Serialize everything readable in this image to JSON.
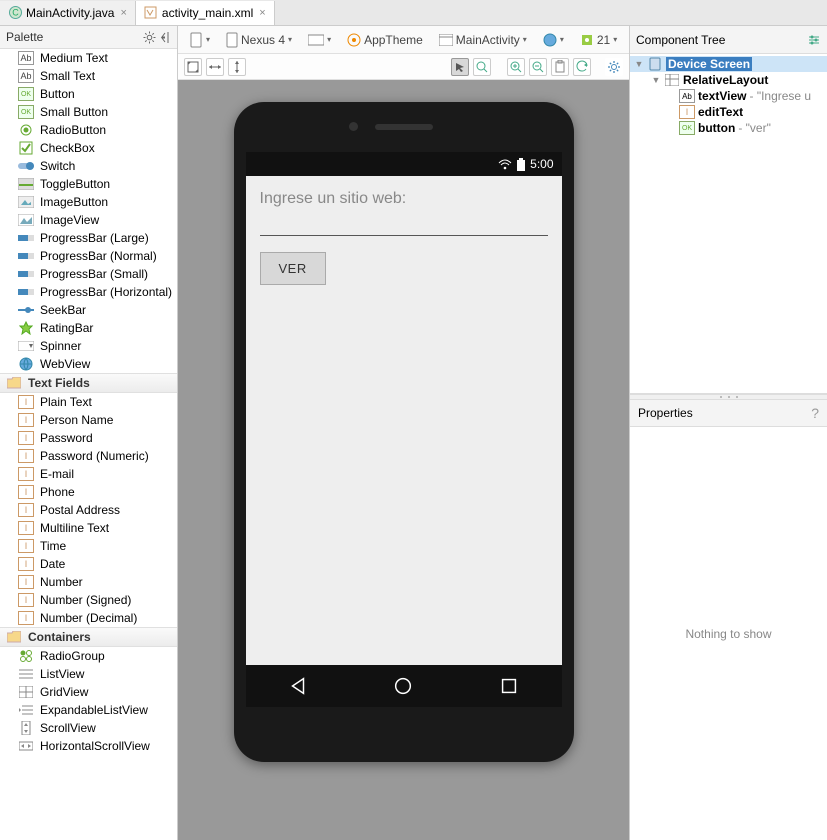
{
  "tabs": [
    {
      "label": "MainActivity.java",
      "icon": "class",
      "active": false
    },
    {
      "label": "activity_main.xml",
      "icon": "xml",
      "active": true
    }
  ],
  "palette": {
    "title": "Palette",
    "items": [
      {
        "label": "Medium Text",
        "icon": "Ab"
      },
      {
        "label": "Small Text",
        "icon": "Ab"
      },
      {
        "label": "Button",
        "icon": "OK"
      },
      {
        "label": "Small Button",
        "icon": "OK"
      },
      {
        "label": "RadioButton",
        "icon": "radio"
      },
      {
        "label": "CheckBox",
        "icon": "check"
      },
      {
        "label": "Switch",
        "icon": "switch"
      },
      {
        "label": "ToggleButton",
        "icon": "toggle"
      },
      {
        "label": "ImageButton",
        "icon": "imgbtn"
      },
      {
        "label": "ImageView",
        "icon": "img"
      },
      {
        "label": "ProgressBar (Large)",
        "icon": "bar"
      },
      {
        "label": "ProgressBar (Normal)",
        "icon": "bar"
      },
      {
        "label": "ProgressBar (Small)",
        "icon": "bar"
      },
      {
        "label": "ProgressBar (Horizontal)",
        "icon": "bar"
      },
      {
        "label": "SeekBar",
        "icon": "seek"
      },
      {
        "label": "RatingBar",
        "icon": "star"
      },
      {
        "label": "Spinner",
        "icon": "spin"
      },
      {
        "label": "WebView",
        "icon": "web"
      }
    ],
    "section_textfields": "Text Fields",
    "textfields": [
      {
        "label": "Plain Text"
      },
      {
        "label": "Person Name"
      },
      {
        "label": "Password"
      },
      {
        "label": "Password (Numeric)"
      },
      {
        "label": "E-mail"
      },
      {
        "label": "Phone"
      },
      {
        "label": "Postal Address"
      },
      {
        "label": "Multiline Text"
      },
      {
        "label": "Time"
      },
      {
        "label": "Date"
      },
      {
        "label": "Number"
      },
      {
        "label": "Number (Signed)"
      },
      {
        "label": "Number (Decimal)"
      }
    ],
    "section_containers": "Containers",
    "containers": [
      {
        "label": "RadioGroup"
      },
      {
        "label": "ListView"
      },
      {
        "label": "GridView"
      },
      {
        "label": "ExpandableListView"
      },
      {
        "label": "ScrollView"
      },
      {
        "label": "HorizontalScrollView"
      }
    ]
  },
  "toolbar": {
    "device": "Nexus 4",
    "theme": "AppTheme",
    "context": "MainActivity",
    "api": "21"
  },
  "statusbar": {
    "time": "5:00"
  },
  "app": {
    "textview": "Ingrese un sitio web:",
    "button": "VER"
  },
  "tree": {
    "title": "Component Tree",
    "root": "Device Screen",
    "layout": "RelativeLayout",
    "nodes": [
      {
        "name": "textView",
        "extra": "\"Ingrese u",
        "icon": "Ab"
      },
      {
        "name": "editText",
        "extra": "",
        "icon": "I"
      },
      {
        "name": "button",
        "extra": "\"ver\"",
        "icon": "OK"
      }
    ]
  },
  "properties": {
    "title": "Properties",
    "empty": "Nothing to show"
  }
}
